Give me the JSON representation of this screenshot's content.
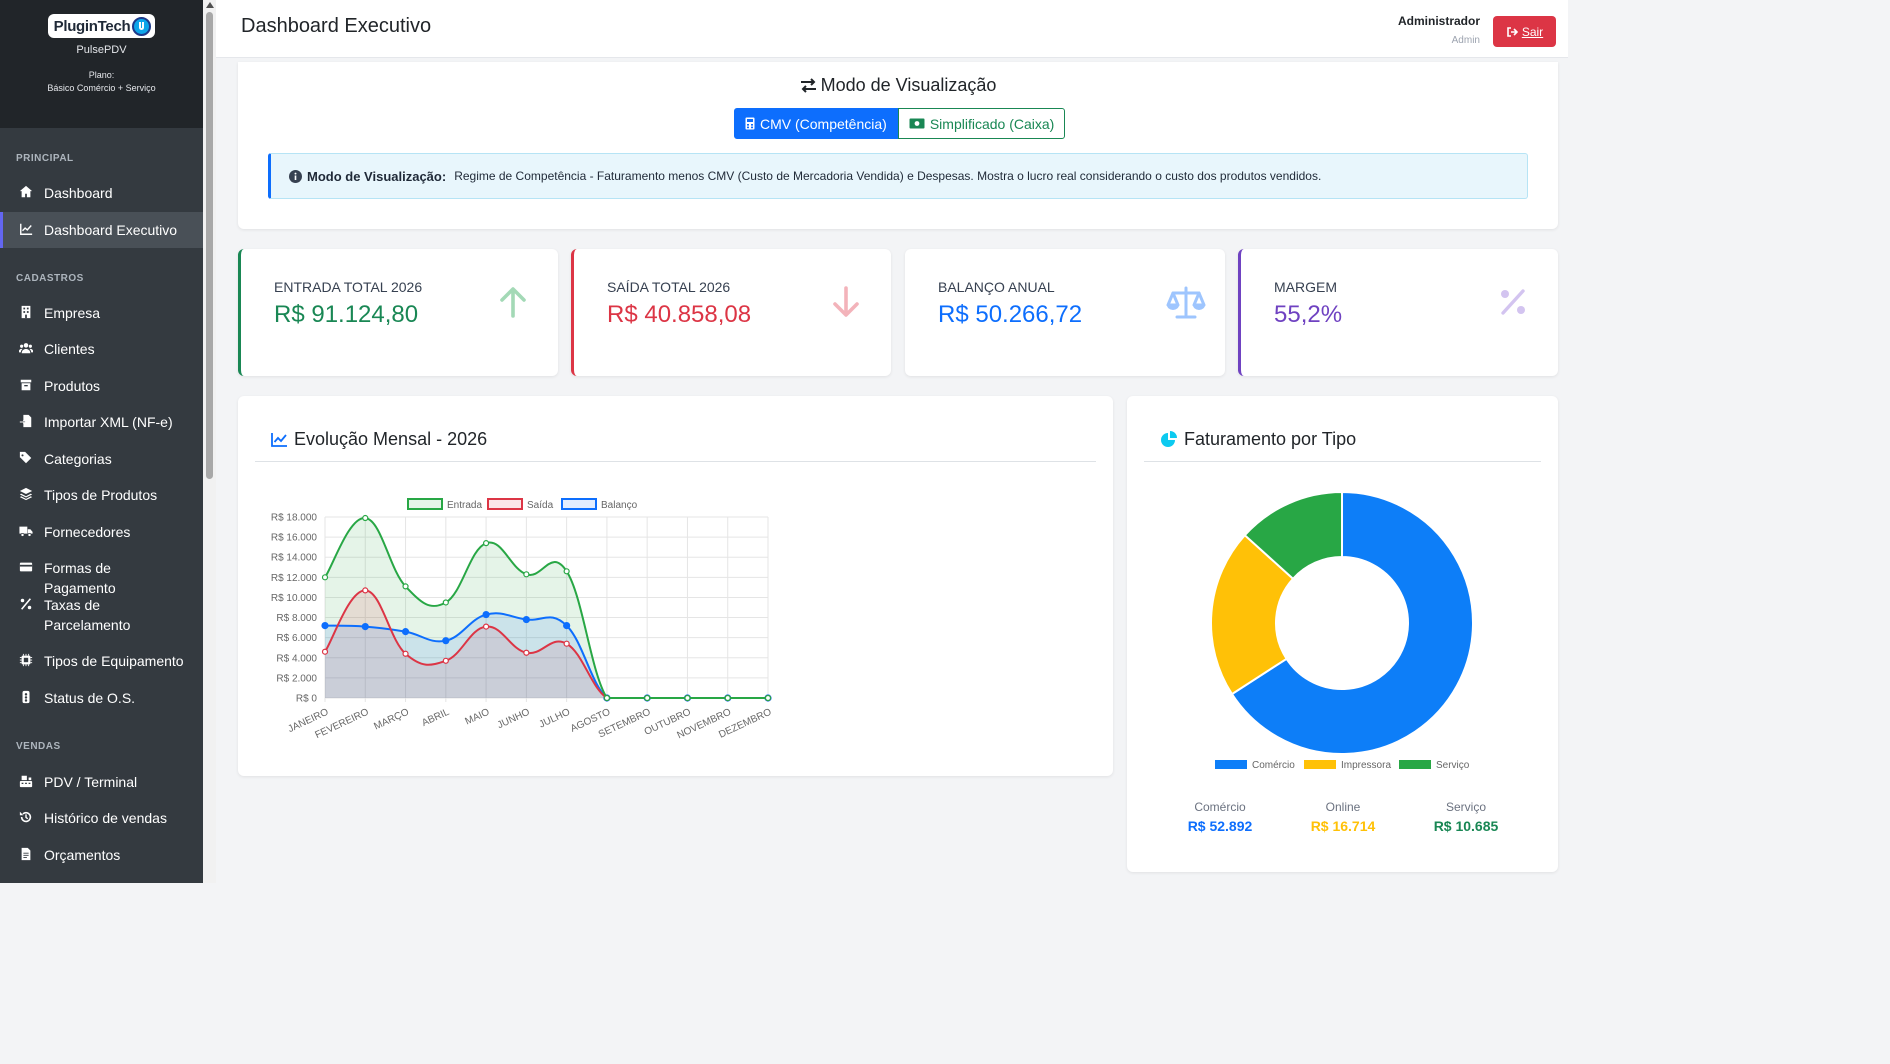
{
  "brand": {
    "logo_text": "PluginTech",
    "app_name": "PulsePDV",
    "plan_label": "Plano:",
    "plan_name": "Básico Comércio + Serviço"
  },
  "sidebar": {
    "sections": [
      {
        "title": "PRINCIPAL",
        "items": [
          {
            "label": "Dashboard",
            "icon": "home-icon"
          },
          {
            "label": "Dashboard Executivo",
            "icon": "chart-line-icon",
            "active": true
          }
        ]
      },
      {
        "title": "CADASTROS",
        "items": [
          {
            "label": "Empresa",
            "icon": "building-icon"
          },
          {
            "label": "Clientes",
            "icon": "users-icon"
          },
          {
            "label": "Produtos",
            "icon": "box-icon"
          },
          {
            "label": "Importar XML (NF-e)",
            "icon": "file-import-icon"
          },
          {
            "label": "Categorias",
            "icon": "tags-icon"
          },
          {
            "label": "Tipos de Produtos",
            "icon": "layers-icon"
          },
          {
            "label": "Fornecedores",
            "icon": "truck-icon"
          },
          {
            "label": "Formas de Pagamento",
            "icon": "credit-card-icon"
          },
          {
            "label": "Taxas de Parcelamento",
            "icon": "percent-icon"
          },
          {
            "label": "Tipos de Equipamento",
            "icon": "microchip-icon"
          },
          {
            "label": "Status de O.S.",
            "icon": "status-icon"
          }
        ]
      },
      {
        "title": "VENDAS",
        "items": [
          {
            "label": "PDV / Terminal",
            "icon": "cash-register-icon"
          },
          {
            "label": "Histórico de vendas",
            "icon": "history-icon"
          },
          {
            "label": "Orçamentos",
            "icon": "document-icon"
          }
        ]
      }
    ]
  },
  "header": {
    "title": "Dashboard Executivo",
    "user_name": "Administrador",
    "user_role": "Admin",
    "logout_label": "Sair"
  },
  "mode": {
    "title": "Modo de Visualização",
    "btn_cmv": "CMV (Competência)",
    "btn_simple": "Simplificado (Caixa)",
    "info_label": "Modo de Visualização:",
    "info_text": "Regime de Competência - Faturamento menos CMV (Custo de Mercadoria Vendida) e Despesas. Mostra o lucro real considerando o custo dos produtos vendidos."
  },
  "stats": [
    {
      "label": "ENTRADA TOTAL 2026",
      "value": "R$ 91.124,80",
      "color": "#198754",
      "icon": "arrow-up-icon"
    },
    {
      "label": "SAÍDA TOTAL 2026",
      "value": "R$ 40.858,08",
      "color": "#dc3545",
      "icon": "arrow-down-icon"
    },
    {
      "label": "BALANÇO ANUAL",
      "value": "R$ 50.266,72",
      "color": "#0d6efd",
      "icon": "balance-scale-icon"
    },
    {
      "label": "MARGEM",
      "value": "55,2%",
      "color": "#6f42c1",
      "icon": "percent-icon"
    }
  ],
  "line_chart_title": "Evolução Mensal - 2026",
  "donut_title": "Faturamento por Tipo",
  "chart_data": [
    {
      "type": "line",
      "title": "Evolução Mensal - 2026",
      "categories": [
        "JANEIRO",
        "FEVEREIRO",
        "MARÇO",
        "ABRIL",
        "MAIO",
        "JUNHO",
        "JULHO",
        "AGOSTO",
        "SETEMBRO",
        "OUTUBRO",
        "NOVEMBRO",
        "DEZEMBRO"
      ],
      "series": [
        {
          "name": "Entrada",
          "color": "#28a745",
          "values": [
            12000,
            17900,
            11100,
            9500,
            15400,
            12300,
            12600,
            0,
            0,
            0,
            0,
            0
          ]
        },
        {
          "name": "Saída",
          "color": "#dc3545",
          "values": [
            4600,
            10700,
            4400,
            3700,
            7100,
            4500,
            5400,
            0,
            0,
            0,
            0,
            0
          ]
        },
        {
          "name": "Balanço",
          "color": "#0d6efd",
          "values": [
            7200,
            7100,
            6600,
            5700,
            8300,
            7800,
            7200,
            0,
            0,
            0,
            0,
            0
          ]
        }
      ],
      "y_ticks": [
        "R$ 18.000",
        "R$ 16.000",
        "R$ 14.000",
        "R$ 12.000",
        "R$ 10.000",
        "R$ 8.000",
        "R$ 6.000",
        "R$ 4.000",
        "R$ 2.000",
        "R$ 0"
      ],
      "ylim": [
        0,
        18000
      ],
      "grid": true,
      "legend": "top"
    },
    {
      "type": "pie",
      "title": "Faturamento por Tipo",
      "labels": [
        "Comércio",
        "Impressora",
        "Serviço"
      ],
      "values": [
        52892,
        16714,
        10685
      ],
      "colors": [
        "#0d7ef8",
        "#ffc107",
        "#28a745"
      ],
      "legend": "bottom"
    }
  ],
  "totals": [
    {
      "label": "Comércio",
      "value": "R$ 52.892",
      "color": "#0d6efd"
    },
    {
      "label": "Online",
      "value": "R$ 16.714",
      "color": "#ffc107"
    },
    {
      "label": "Serviço",
      "value": "R$ 10.685",
      "color": "#198754"
    }
  ]
}
